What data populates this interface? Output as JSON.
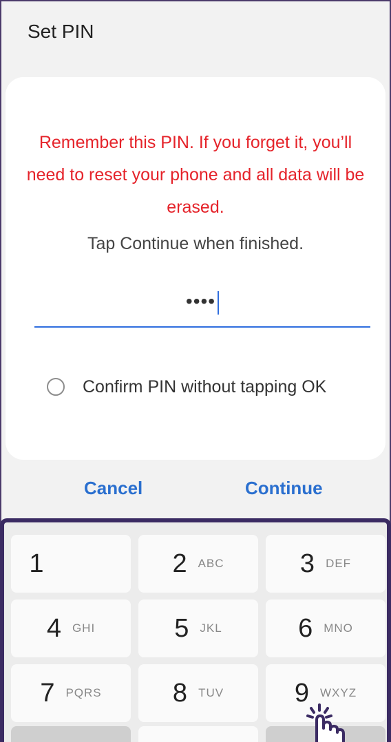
{
  "header": {
    "title": "Set PIN"
  },
  "dialog": {
    "warning": "Remember this PIN. If you forget it, you’ll need to reset your phone and all data will be erased.",
    "hint": "Tap Continue when finished.",
    "pin_value": "••••",
    "confirm_label": "Confirm PIN without tapping OK"
  },
  "actions": {
    "cancel": "Cancel",
    "continue": "Continue"
  },
  "keypad": {
    "keys": [
      {
        "num": "1",
        "letters": ""
      },
      {
        "num": "2",
        "letters": "ABC"
      },
      {
        "num": "3",
        "letters": "DEF"
      },
      {
        "num": "4",
        "letters": "GHI"
      },
      {
        "num": "5",
        "letters": "JKL"
      },
      {
        "num": "6",
        "letters": "MNO"
      },
      {
        "num": "7",
        "letters": "PQRS"
      },
      {
        "num": "8",
        "letters": "TUV"
      },
      {
        "num": "9",
        "letters": "WXYZ"
      }
    ]
  },
  "colors": {
    "warning": "#e5232a",
    "accent": "#2a6fcf",
    "frame": "#3b2b63"
  },
  "icons": {
    "pointer": "tap-hand-icon",
    "radio": "radio-unchecked-icon"
  }
}
